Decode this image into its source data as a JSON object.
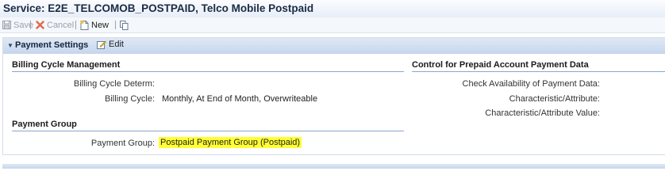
{
  "header": {
    "title": "Service: E2E_TELCOMOB_POSTPAID, Telco Mobile Postpaid"
  },
  "toolbar": {
    "save_label": "Save",
    "cancel_label": "Cancel",
    "new_label": "New",
    "copy_icon": "copy-icon"
  },
  "panel": {
    "title": "Payment Settings",
    "edit_label": "Edit",
    "billing": {
      "heading": "Billing Cycle Management",
      "determ_label": "Billing Cycle Determ:",
      "determ_value": "",
      "cycle_label": "Billing Cycle:",
      "cycle_value": "Monthly, At End of Month, Overwriteable"
    },
    "payment_group": {
      "heading": "Payment Group",
      "label": "Payment Group:",
      "value": "Postpaid Payment Group (Postpaid)",
      "highlight_color": "#ffff33"
    },
    "prepaid": {
      "heading": "Control for Prepaid Account Payment Data",
      "availability_label": "Check Availability of Payment Data:",
      "char_attr_label": "Characteristic/Attribute:",
      "char_attr_value_label": "Characteristic/Attribute Value:"
    }
  }
}
